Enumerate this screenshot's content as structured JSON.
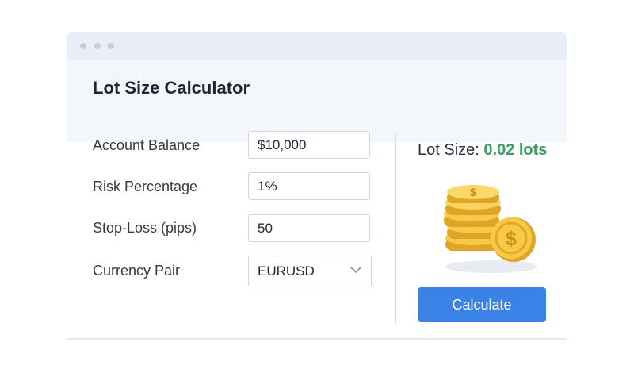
{
  "window": {
    "title": "Lot Size Calculator"
  },
  "form": {
    "account_balance": {
      "label": "Account Balance",
      "value": "$10,000"
    },
    "risk_percentage": {
      "label": "Risk Percentage",
      "value": "1%"
    },
    "stop_loss": {
      "label": "Stop-Loss (pips)",
      "value": "50"
    },
    "currency_pair": {
      "label": "Currency Pair",
      "value": "EURUSD"
    }
  },
  "result": {
    "label": "Lot Size:",
    "value": "0.02 lots",
    "value_color": "#3f9c63"
  },
  "actions": {
    "calculate_label": "Calculate",
    "calculate_color": "#3b82e6"
  },
  "icons": {
    "window_controls": [
      "dot-icon",
      "dot-icon",
      "dot-icon"
    ],
    "illustration": "dollar-coins-icon",
    "select_arrow": "chevron-down-icon"
  }
}
